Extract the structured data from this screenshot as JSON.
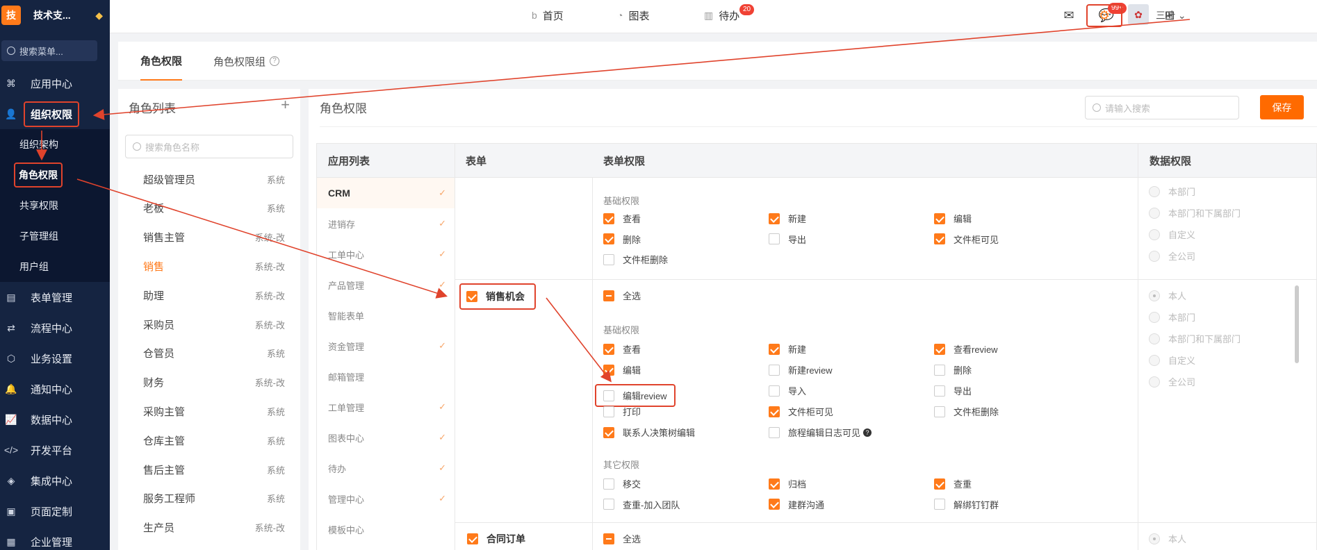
{
  "sidebar": {
    "logo": "技",
    "brand": "技术支...",
    "search_placeholder": "搜索菜单...",
    "items": [
      {
        "label": "应用中心"
      },
      {
        "label": "组织权限"
      },
      {
        "label": "表单管理"
      },
      {
        "label": "流程中心"
      },
      {
        "label": "业务设置"
      },
      {
        "label": "通知中心"
      },
      {
        "label": "数据中心"
      },
      {
        "label": "开发平台"
      },
      {
        "label": "集成中心"
      },
      {
        "label": "页面定制"
      },
      {
        "label": "企业管理"
      }
    ],
    "subitems": [
      {
        "label": "组织架构"
      },
      {
        "label": "角色权限"
      },
      {
        "label": "共享权限"
      },
      {
        "label": "子管理组"
      },
      {
        "label": "用户组"
      }
    ]
  },
  "topbar": {
    "home": "首页",
    "chart": "图表",
    "todo": "待办",
    "todo_badge": "20",
    "msg_badge": "99+",
    "user": "三叶"
  },
  "tabs": {
    "role_perm": "角色权限",
    "role_group": "角色权限组",
    "help": "?"
  },
  "roles": {
    "title": "角色列表",
    "add": "+",
    "search_placeholder": "搜索角色名称",
    "list": [
      {
        "name": "超级管理员",
        "tag": "系统"
      },
      {
        "name": "老板",
        "tag": "系统"
      },
      {
        "name": "销售主管",
        "tag": "系统-改"
      },
      {
        "name": "销售",
        "tag": "系统-改"
      },
      {
        "name": "助理",
        "tag": "系统-改"
      },
      {
        "name": "采购员",
        "tag": "系统-改"
      },
      {
        "name": "仓管员",
        "tag": "系统"
      },
      {
        "name": "财务",
        "tag": "系统-改"
      },
      {
        "name": "采购主管",
        "tag": "系统"
      },
      {
        "name": "仓库主管",
        "tag": "系统"
      },
      {
        "name": "售后主管",
        "tag": "系统"
      },
      {
        "name": "服务工程师",
        "tag": "系统"
      },
      {
        "name": "生产员",
        "tag": "系统-改"
      }
    ]
  },
  "perm": {
    "title": "角色权限",
    "search_placeholder": "请输入搜索",
    "save": "保存",
    "headers": {
      "apps": "应用列表",
      "form": "表单",
      "form_perm": "表单权限",
      "data_perm": "数据权限"
    },
    "apps": [
      {
        "name": "CRM",
        "checked": true
      },
      {
        "name": "进销存",
        "checked": true
      },
      {
        "name": "工单中心",
        "checked": true
      },
      {
        "name": "产品管理",
        "checked": true
      },
      {
        "name": "智能表单",
        "checked": false
      },
      {
        "name": "资金管理",
        "checked": true
      },
      {
        "name": "邮箱管理",
        "checked": false
      },
      {
        "name": "工单管理",
        "checked": true
      },
      {
        "name": "图表中心",
        "checked": true
      },
      {
        "name": "待办",
        "checked": true
      },
      {
        "name": "管理中心",
        "checked": true
      },
      {
        "name": "模板中心",
        "checked": false
      }
    ],
    "basic_label": "基础权限",
    "other_label": "其它权限",
    "select_all": "全选",
    "block0": {
      "perms": [
        {
          "label": "查看",
          "on": true
        },
        {
          "label": "新建",
          "on": true
        },
        {
          "label": "编辑",
          "on": true
        },
        {
          "label": "删除",
          "on": true
        },
        {
          "label": "导出",
          "on": false
        },
        {
          "label": "文件柜可见",
          "on": true
        },
        {
          "label": "文件柜删除",
          "on": false
        }
      ],
      "data": [
        "本部门",
        "本部门和下属部门",
        "自定义",
        "全公司"
      ]
    },
    "block1": {
      "form": "销售机会",
      "basic": [
        {
          "label": "查看",
          "on": true
        },
        {
          "label": "新建",
          "on": true
        },
        {
          "label": "查看review",
          "on": true
        },
        {
          "label": "编辑",
          "on": true
        },
        {
          "label": "新建review",
          "on": false
        },
        {
          "label": "删除",
          "on": false
        },
        {
          "label": "编辑review",
          "on": false
        },
        {
          "label": "导入",
          "on": false
        },
        {
          "label": "导出",
          "on": false
        },
        {
          "label": "打印",
          "on": false
        },
        {
          "label": "文件柜可见",
          "on": true
        },
        {
          "label": "文件柜删除",
          "on": false
        },
        {
          "label": "联系人决策树编辑",
          "on": true
        },
        {
          "label": "旅程编辑日志可见",
          "on": false
        }
      ],
      "other": [
        {
          "label": "移交",
          "on": false
        },
        {
          "label": "归档",
          "on": true
        },
        {
          "label": "查重",
          "on": true
        },
        {
          "label": "查重-加入团队",
          "on": false
        },
        {
          "label": "建群沟通",
          "on": true
        },
        {
          "label": "解绑钉钉群",
          "on": false
        }
      ],
      "data": [
        "本人",
        "本部门",
        "本部门和下属部门",
        "自定义",
        "全公司"
      ]
    },
    "block2": {
      "form": "合同订单",
      "data": "本人"
    }
  },
  "colors": {
    "accent": "#ff7a1a",
    "sidebar": "#152441",
    "annotation": "#e0432c"
  }
}
